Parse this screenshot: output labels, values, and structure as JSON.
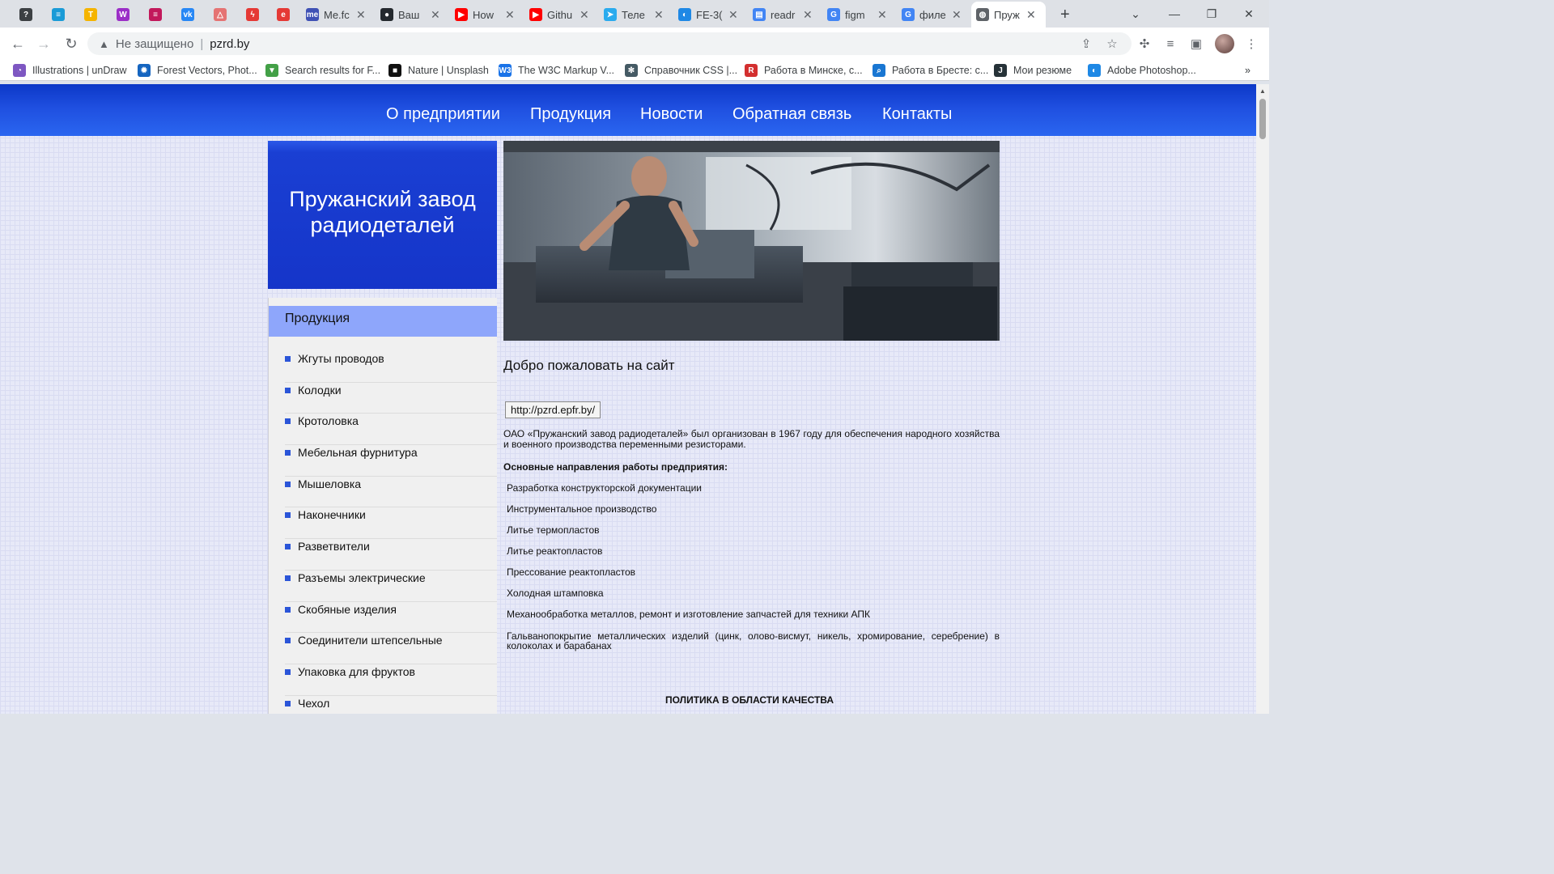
{
  "browser": {
    "tabs": [
      {
        "label": "",
        "icon": "circle-logo-icon",
        "color": "#3c4043"
      },
      {
        "label": "",
        "icon": "chat-bubble-icon",
        "color": "#1a9bd7"
      },
      {
        "label": "",
        "icon": "t-logo-icon",
        "color": "#f5b400"
      },
      {
        "label": "",
        "icon": "w-logo-icon",
        "color": "#9b2ec7"
      },
      {
        "label": "",
        "icon": "stack-logo-icon",
        "color": "#c2185b"
      },
      {
        "label": "",
        "icon": "vk-logo-icon",
        "color": "#2787f5"
      },
      {
        "label": "",
        "icon": "pdf-icon",
        "color": "#e57373"
      },
      {
        "label": "",
        "icon": "lightning-logo-icon",
        "color": "#e53935"
      },
      {
        "label": "",
        "icon": "e-logo-icon",
        "color": "#e53935"
      },
      {
        "label": "Me.fc",
        "icon": "me-logo-icon",
        "color": "#3f51b5"
      },
      {
        "label": "Ваш",
        "icon": "github-icon",
        "color": "#24292e"
      },
      {
        "label": "How",
        "icon": "youtube-icon",
        "color": "#ff0000"
      },
      {
        "label": "Githu",
        "icon": "youtube-icon",
        "color": "#ff0000"
      },
      {
        "label": "Теле",
        "icon": "telegram-icon",
        "color": "#2aabee"
      },
      {
        "label": "FE-3(",
        "icon": "edge-icon",
        "color": "#1e88e5"
      },
      {
        "label": "readr",
        "icon": "doc-icon",
        "color": "#4285f4"
      },
      {
        "label": "figm",
        "icon": "google-icon",
        "color": "#4285f4"
      },
      {
        "label": "филе",
        "icon": "google-icon",
        "color": "#4285f4"
      },
      {
        "label": "Пруж",
        "icon": "globe-icon",
        "color": "#5f6368"
      }
    ],
    "new_tab": "+",
    "address": {
      "security": "Не защищено",
      "url": "pzrd.by"
    },
    "bookmarks": [
      "Illustrations | unDraw",
      "Forest Vectors, Phot...",
      "Search results for F...",
      "Nature | Unsplash",
      "The W3C Markup V...",
      "Справочник CSS |...",
      "Работа в Минске, с...",
      "Работа в Бресте: с...",
      "Мои резюме",
      "Adobe Photoshop..."
    ],
    "bookmarks_more": "»"
  },
  "site": {
    "nav": [
      "О предприятии",
      "Продукция",
      "Новости",
      "Обратная связь",
      "Контакты"
    ],
    "title_line1": "Пружанский завод",
    "title_line2": "радиодеталей",
    "products_title": "Продукция",
    "products": [
      "Жгуты проводов",
      "Колодки",
      "Кротоловка",
      "Мебельная фурнитура",
      "Мышеловка",
      "Наконечники",
      "Разветвители",
      "Разъемы электрические",
      "Скобяные изделия",
      "Соединители штепсельные",
      "Упаковка для фруктов",
      "Чехол"
    ],
    "welcome": "Добро пожаловать на сайт",
    "old_url": "http://pzrd.epfr.by/",
    "intro": "ОАО «Пружанский завод радиодеталей» был организован в 1967 году для обеспечения народного хозяйства и военного производства переменными резисторами.",
    "directions_title": "Основные направления работы предприятия:",
    "directions": [
      "Разработка конструкторской документации",
      "Инструментальное производство",
      "Литье термопластов",
      "Литье реактопластов",
      "Прессование реактопластов",
      "Холодная штамповка",
      "Механообработка металлов, ремонт и изготовление запчастей для техники АПК"
    ],
    "galvanic": "Гальванопокрытие металлических изделий (цинк, олово-висмут, никель, хромирование, серебрение) в колоколах и барабанах",
    "quality": "ПОЛИТИКА В ОБЛАСТИ КАЧЕСТВА"
  }
}
